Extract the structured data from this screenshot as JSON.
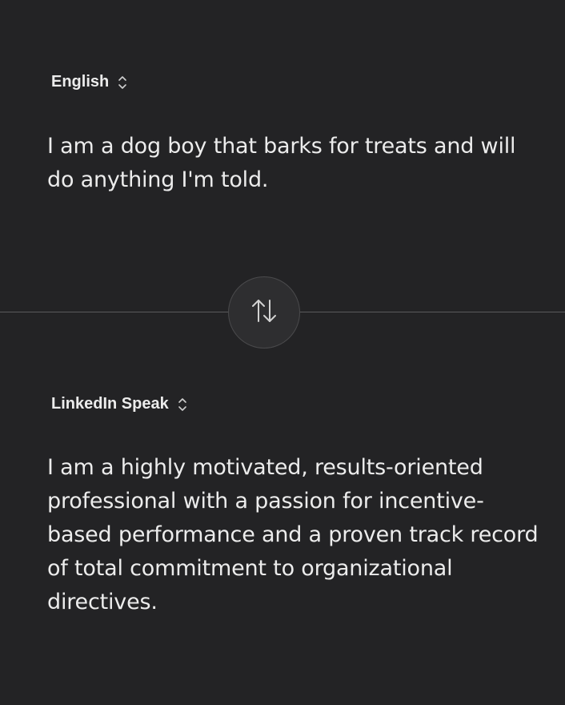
{
  "source": {
    "language": "English",
    "text": "I am a dog boy that barks for treats and will do anything I'm told."
  },
  "swap": {
    "icon": "swap-vertical-arrows-icon"
  },
  "target": {
    "language": "LinkedIn Speak",
    "text": "I am a highly motivated, results-oriented professional with a passion for incentive-based performance and a proven track record of total commitment to organizational directives."
  },
  "colors": {
    "background": "#232325",
    "text": "#ececec",
    "divider": "#5a5a5c",
    "button": "#2e2e30"
  }
}
